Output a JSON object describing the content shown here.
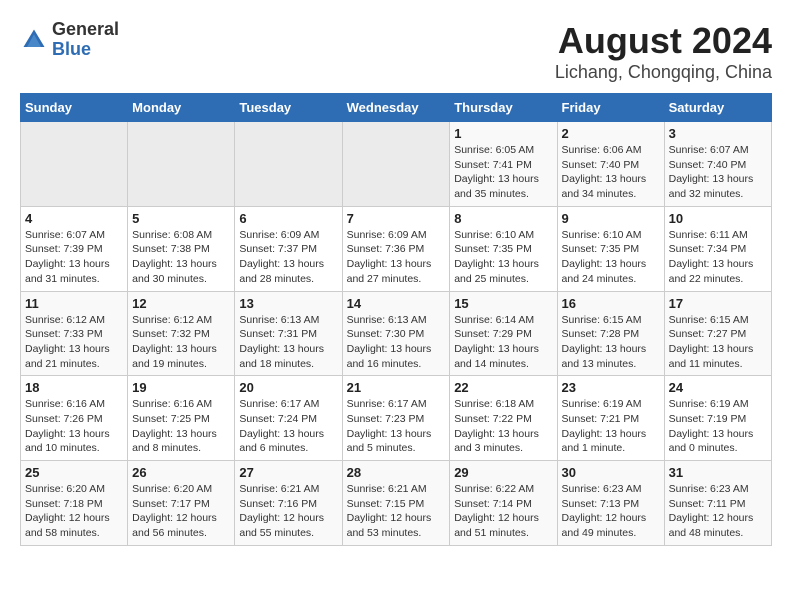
{
  "header": {
    "logo": {
      "general": "General",
      "blue": "Blue"
    },
    "title": "August 2024",
    "subtitle": "Lichang, Chongqing, China"
  },
  "calendar": {
    "days_of_week": [
      "Sunday",
      "Monday",
      "Tuesday",
      "Wednesday",
      "Thursday",
      "Friday",
      "Saturday"
    ],
    "weeks": [
      {
        "days": [
          {
            "num": "",
            "detail": ""
          },
          {
            "num": "",
            "detail": ""
          },
          {
            "num": "",
            "detail": ""
          },
          {
            "num": "",
            "detail": ""
          },
          {
            "num": "1",
            "detail": "Sunrise: 6:05 AM\nSunset: 7:41 PM\nDaylight: 13 hours\nand 35 minutes."
          },
          {
            "num": "2",
            "detail": "Sunrise: 6:06 AM\nSunset: 7:40 PM\nDaylight: 13 hours\nand 34 minutes."
          },
          {
            "num": "3",
            "detail": "Sunrise: 6:07 AM\nSunset: 7:40 PM\nDaylight: 13 hours\nand 32 minutes."
          }
        ]
      },
      {
        "days": [
          {
            "num": "4",
            "detail": "Sunrise: 6:07 AM\nSunset: 7:39 PM\nDaylight: 13 hours\nand 31 minutes."
          },
          {
            "num": "5",
            "detail": "Sunrise: 6:08 AM\nSunset: 7:38 PM\nDaylight: 13 hours\nand 30 minutes."
          },
          {
            "num": "6",
            "detail": "Sunrise: 6:09 AM\nSunset: 7:37 PM\nDaylight: 13 hours\nand 28 minutes."
          },
          {
            "num": "7",
            "detail": "Sunrise: 6:09 AM\nSunset: 7:36 PM\nDaylight: 13 hours\nand 27 minutes."
          },
          {
            "num": "8",
            "detail": "Sunrise: 6:10 AM\nSunset: 7:35 PM\nDaylight: 13 hours\nand 25 minutes."
          },
          {
            "num": "9",
            "detail": "Sunrise: 6:10 AM\nSunset: 7:35 PM\nDaylight: 13 hours\nand 24 minutes."
          },
          {
            "num": "10",
            "detail": "Sunrise: 6:11 AM\nSunset: 7:34 PM\nDaylight: 13 hours\nand 22 minutes."
          }
        ]
      },
      {
        "days": [
          {
            "num": "11",
            "detail": "Sunrise: 6:12 AM\nSunset: 7:33 PM\nDaylight: 13 hours\nand 21 minutes."
          },
          {
            "num": "12",
            "detail": "Sunrise: 6:12 AM\nSunset: 7:32 PM\nDaylight: 13 hours\nand 19 minutes."
          },
          {
            "num": "13",
            "detail": "Sunrise: 6:13 AM\nSunset: 7:31 PM\nDaylight: 13 hours\nand 18 minutes."
          },
          {
            "num": "14",
            "detail": "Sunrise: 6:13 AM\nSunset: 7:30 PM\nDaylight: 13 hours\nand 16 minutes."
          },
          {
            "num": "15",
            "detail": "Sunrise: 6:14 AM\nSunset: 7:29 PM\nDaylight: 13 hours\nand 14 minutes."
          },
          {
            "num": "16",
            "detail": "Sunrise: 6:15 AM\nSunset: 7:28 PM\nDaylight: 13 hours\nand 13 minutes."
          },
          {
            "num": "17",
            "detail": "Sunrise: 6:15 AM\nSunset: 7:27 PM\nDaylight: 13 hours\nand 11 minutes."
          }
        ]
      },
      {
        "days": [
          {
            "num": "18",
            "detail": "Sunrise: 6:16 AM\nSunset: 7:26 PM\nDaylight: 13 hours\nand 10 minutes."
          },
          {
            "num": "19",
            "detail": "Sunrise: 6:16 AM\nSunset: 7:25 PM\nDaylight: 13 hours\nand 8 minutes."
          },
          {
            "num": "20",
            "detail": "Sunrise: 6:17 AM\nSunset: 7:24 PM\nDaylight: 13 hours\nand 6 minutes."
          },
          {
            "num": "21",
            "detail": "Sunrise: 6:17 AM\nSunset: 7:23 PM\nDaylight: 13 hours\nand 5 minutes."
          },
          {
            "num": "22",
            "detail": "Sunrise: 6:18 AM\nSunset: 7:22 PM\nDaylight: 13 hours\nand 3 minutes."
          },
          {
            "num": "23",
            "detail": "Sunrise: 6:19 AM\nSunset: 7:21 PM\nDaylight: 13 hours\nand 1 minute."
          },
          {
            "num": "24",
            "detail": "Sunrise: 6:19 AM\nSunset: 7:19 PM\nDaylight: 13 hours\nand 0 minutes."
          }
        ]
      },
      {
        "days": [
          {
            "num": "25",
            "detail": "Sunrise: 6:20 AM\nSunset: 7:18 PM\nDaylight: 12 hours\nand 58 minutes."
          },
          {
            "num": "26",
            "detail": "Sunrise: 6:20 AM\nSunset: 7:17 PM\nDaylight: 12 hours\nand 56 minutes."
          },
          {
            "num": "27",
            "detail": "Sunrise: 6:21 AM\nSunset: 7:16 PM\nDaylight: 12 hours\nand 55 minutes."
          },
          {
            "num": "28",
            "detail": "Sunrise: 6:21 AM\nSunset: 7:15 PM\nDaylight: 12 hours\nand 53 minutes."
          },
          {
            "num": "29",
            "detail": "Sunrise: 6:22 AM\nSunset: 7:14 PM\nDaylight: 12 hours\nand 51 minutes."
          },
          {
            "num": "30",
            "detail": "Sunrise: 6:23 AM\nSunset: 7:13 PM\nDaylight: 12 hours\nand 49 minutes."
          },
          {
            "num": "31",
            "detail": "Sunrise: 6:23 AM\nSunset: 7:11 PM\nDaylight: 12 hours\nand 48 minutes."
          }
        ]
      }
    ]
  }
}
